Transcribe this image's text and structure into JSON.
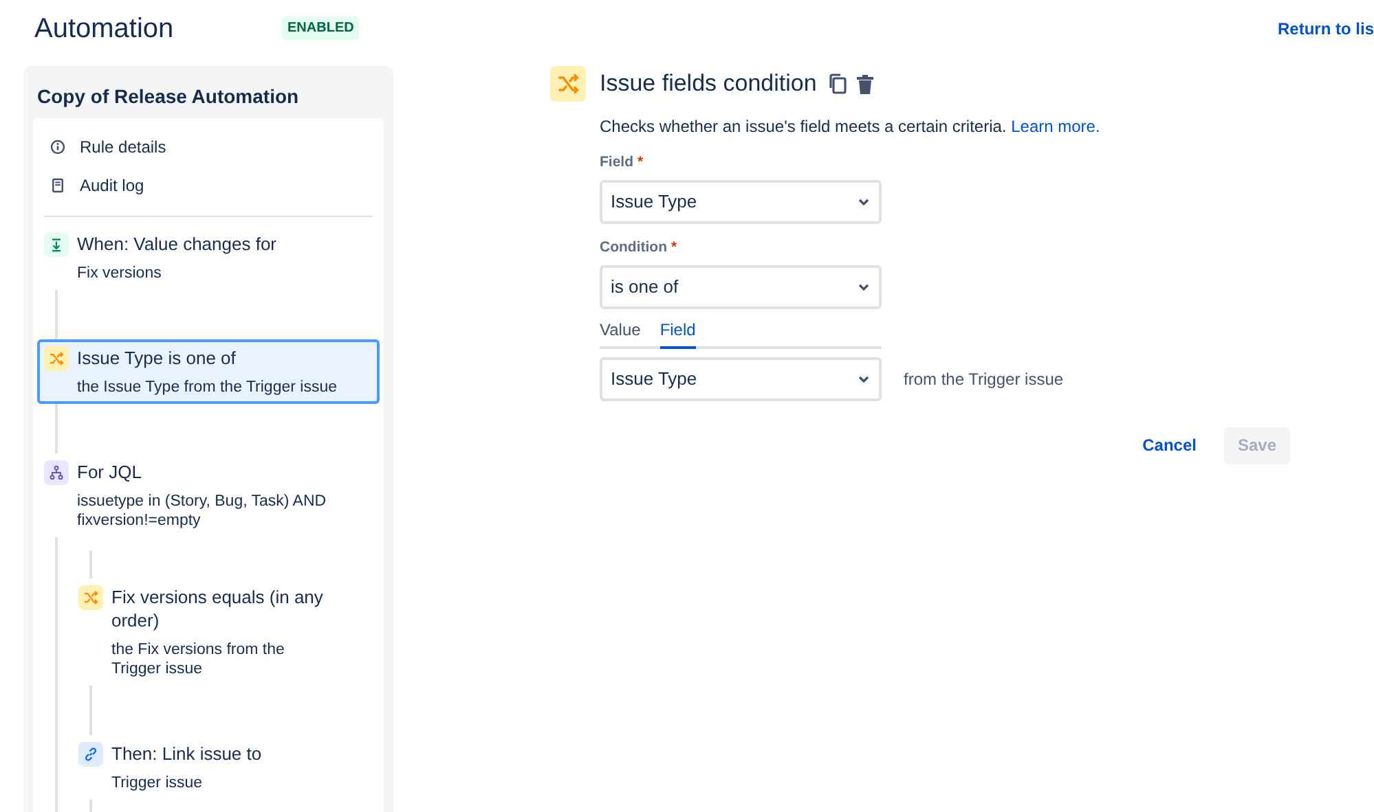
{
  "header": {
    "title": "Automation",
    "status_badge": "ENABLED",
    "return_link": "Return to lis"
  },
  "sidebar": {
    "title": "Copy of Release Automation",
    "nav": [
      {
        "kind": "info",
        "label": "Rule details"
      },
      {
        "kind": "log",
        "label": "Audit log"
      }
    ],
    "steps": [
      {
        "kind": "trigger",
        "title": "When: Value changes for",
        "detail": "Fix versions",
        "selected": false
      },
      {
        "kind": "condition",
        "title": "Issue Type is one of",
        "detail": "the Issue Type from the Trigger issue",
        "selected": true
      },
      {
        "kind": "branch",
        "title": "For JQL",
        "detail": "issuetype in (Story, Bug, Task) AND fixversion!=empty",
        "selected": false,
        "children": [
          {
            "kind": "condition",
            "title": "Fix versions equals (in any order)",
            "detail": "the Fix versions from the Trigger issue",
            "selected": false
          },
          {
            "kind": "action",
            "title": "Then: Link issue to",
            "detail": "Trigger issue",
            "selected": false
          }
        ]
      }
    ]
  },
  "panel": {
    "title": "Issue fields condition",
    "description": "Checks whether an issue's field meets a certain criteria.",
    "learn_more": "Learn more.",
    "fields": [
      {
        "label": "Field",
        "required_mark": "*",
        "value": "Issue Type"
      },
      {
        "label": "Condition",
        "required_mark": "*",
        "value": "is one of"
      }
    ],
    "tabs": [
      {
        "label": "Value",
        "selected": false
      },
      {
        "label": "Field",
        "selected": true
      }
    ],
    "compare_select": {
      "value": "Issue Type",
      "suffix": "from the Trigger issue"
    },
    "buttons": [
      {
        "kind": "link",
        "label": "Cancel",
        "disabled": false
      },
      {
        "kind": "primary",
        "label": "Save",
        "disabled": true
      }
    ]
  }
}
